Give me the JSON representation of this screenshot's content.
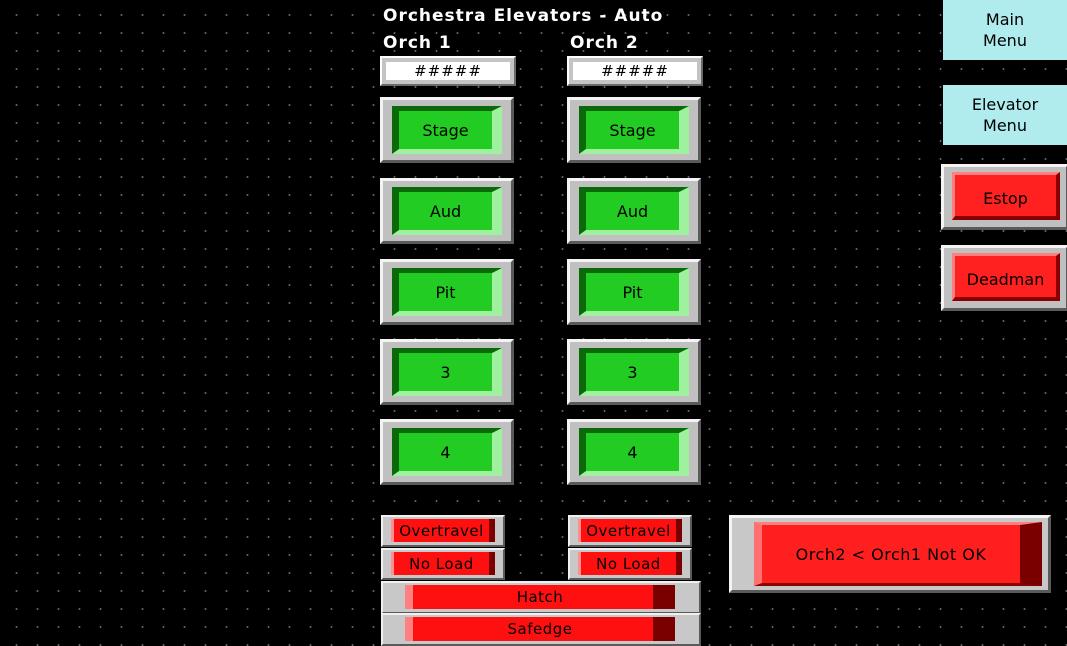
{
  "header": {
    "title": "Orchestra Elevators - Auto"
  },
  "orch1": {
    "label": "Orch 1",
    "readout": "#####",
    "buttons": [
      "Stage",
      "Aud",
      "Pit",
      "3",
      "4"
    ],
    "status": {
      "overtravel": "Overtravel",
      "no_load": "No Load"
    }
  },
  "orch2": {
    "label": "Orch 2",
    "readout": "#####",
    "buttons": [
      "Stage",
      "Aud",
      "Pit",
      "3",
      "4"
    ],
    "status": {
      "overtravel": "Overtravel",
      "no_load": "No Load"
    }
  },
  "shared_status": {
    "hatch": "Hatch",
    "safedge": "Safedge"
  },
  "nav": {
    "main_menu": "Main\nMenu",
    "elevator_menu": "Elevator\nMenu"
  },
  "controls": {
    "estop": "Estop",
    "deadman": "Deadman"
  },
  "alarm": {
    "orch_compare": "Orch2 < Orch1 Not OK"
  },
  "colors": {
    "background": "#000000",
    "button_green": "#22cc22",
    "alarm_red": "#ff1010",
    "nav_cyan": "#b0ecee",
    "frame_gray": "#c0c0c0"
  }
}
